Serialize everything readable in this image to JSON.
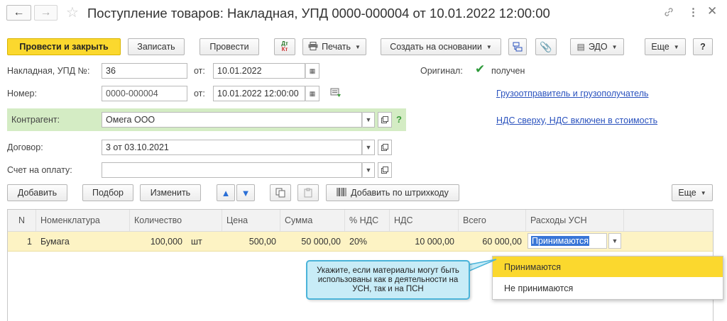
{
  "window": {
    "title": "Поступление товаров: Накладная, УПД 0000-000004 от 10.01.2022 12:00:00"
  },
  "toolbar": {
    "post_close": "Провести и закрыть",
    "save": "Записать",
    "post": "Провести",
    "dt_kt": "Дт",
    "dt_kt2": "Кт",
    "print": "Печать",
    "create_based": "Создать на основании",
    "edo": "ЭДО",
    "more": "Еще",
    "help": "?"
  },
  "form": {
    "invoice_label": "Накладная, УПД №:",
    "invoice_value": "36",
    "from_label": "от:",
    "invoice_date": "10.01.2022",
    "original_label": "Оригинал:",
    "original_value": "получен",
    "number_label": "Номер:",
    "number_value": "0000-000004",
    "number_date": "10.01.2022 12:00:00",
    "link_shipper": "Грузоотправитель и грузополучатель",
    "counterparty_label": "Контрагент:",
    "counterparty_value": "Омега ООО",
    "help_q": "?",
    "link_vat": "НДС сверху, НДС включен в стоимость",
    "contract_label": "Договор:",
    "contract_value": "3 от 03.10.2021",
    "payment_label": "Счет на оплату:",
    "payment_value": ""
  },
  "table_toolbar": {
    "add": "Добавить",
    "select": "Подбор",
    "change": "Изменить",
    "add_barcode": "Добавить по штрихкоду",
    "more": "Еще"
  },
  "table": {
    "headers": [
      "N",
      "Номенклатура",
      "Количество",
      "Цена",
      "Сумма",
      "% НДС",
      "НДС",
      "Всего",
      "Расходы УСН"
    ],
    "row": {
      "n": "1",
      "item": "Бумага",
      "qty": "100,000",
      "unit": "шт",
      "price": "500,00",
      "sum": "50 000,00",
      "vat_rate": "20%",
      "vat": "10 000,00",
      "total": "60 000,00",
      "usn": "Принимаются"
    }
  },
  "dropdown": {
    "options": [
      "Принимаются",
      "Не принимаются"
    ]
  },
  "callout": {
    "text": "Укажите, если материалы могут быть использованы как в деятельности на УСН, так и на ПСН"
  },
  "colors": {
    "primary_button": "#fbd82e",
    "counterparty_bg": "#d4ecc4",
    "selected_row": "#fdf3c4",
    "callout_bg": "#c8ecf7",
    "callout_border": "#4ab3d9",
    "link": "#2a52be"
  }
}
